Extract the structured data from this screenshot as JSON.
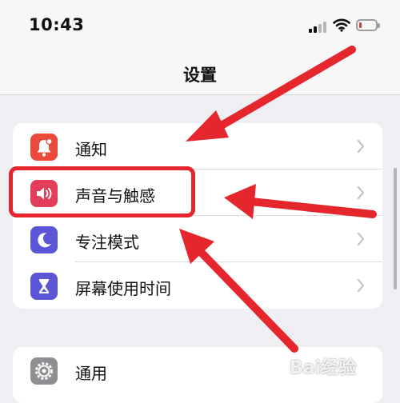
{
  "status_bar": {
    "time": "10:43",
    "battery_level": 0.15,
    "battery_color": "#e23a33"
  },
  "nav": {
    "title": "设置"
  },
  "settings": {
    "group1": [
      {
        "label": "通知",
        "icon": "bell-icon",
        "color": "#ea4a3c"
      },
      {
        "label": "声音与触感",
        "icon": "speaker-icon",
        "color": "#e23d59"
      },
      {
        "label": "专注模式",
        "icon": "moon-icon",
        "color": "#5a56d6"
      },
      {
        "label": "屏幕使用时间",
        "icon": "hourglass-icon",
        "color": "#5a56d6"
      }
    ],
    "group2": [
      {
        "label": "通用",
        "icon": "gear-icon",
        "color": "#8e8e93"
      }
    ]
  },
  "annotation": {
    "highlight_color": "#e5262c",
    "arrow_color": "#e5262c"
  },
  "watermark": {
    "text": "Bai经验"
  }
}
